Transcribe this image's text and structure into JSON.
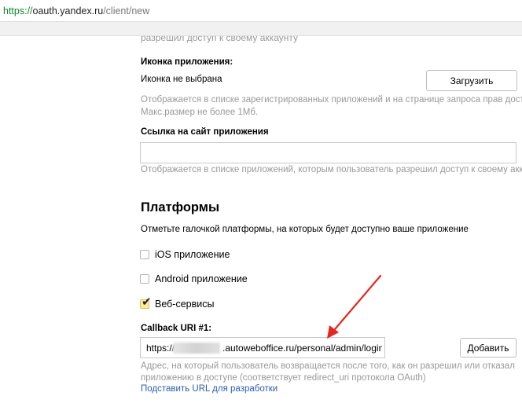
{
  "browser": {
    "url_scheme": "https://",
    "url_host": "oauth.yandex.ru",
    "url_path": "/client/new"
  },
  "form": {
    "cut_off_text": "разрешил доступ к своему аккаунту",
    "icon_section": {
      "label": "Иконка приложения:",
      "status": "Иконка не выбрана",
      "upload_button": "Загрузить",
      "hint_line1": "Отображается в списке зарегистрированных приложений и на странице запроса прав доступа.",
      "hint_line2": "Макс.размер не более 1Мб."
    },
    "site_link": {
      "label": "Ссылка на сайт приложения",
      "value": "",
      "hint": "Отображается в списке приложений, которым пользователь разрешил доступ к своему аккаунту"
    },
    "platforms": {
      "title": "Платформы",
      "description": "Отметьте галочкой платформы, на которых будет доступно ваше приложение",
      "options": [
        {
          "label": "iOS приложение",
          "checked": false
        },
        {
          "label": "Android приложение",
          "checked": false
        },
        {
          "label": "Веб-сервисы",
          "checked": true
        }
      ]
    },
    "callback": {
      "label": "Callback URI #1:",
      "value_prefix": "https://",
      "value_suffix": ".autoweboffice.ru/personal/admin/logins",
      "add_button": "Добавить",
      "hint_line1": "Адрес, на который пользователь возвращается после того, как он разрешил или отказал",
      "hint_line2": "приложению в доступе (соответствует redirect_uri протокола OAuth)",
      "dev_link": "Подставить URL для разработки"
    }
  },
  "colors": {
    "annotation_arrow": "#e8251f",
    "checkbox_checked": "#ffeb99",
    "link": "#2a5db0",
    "hint": "#999999"
  }
}
